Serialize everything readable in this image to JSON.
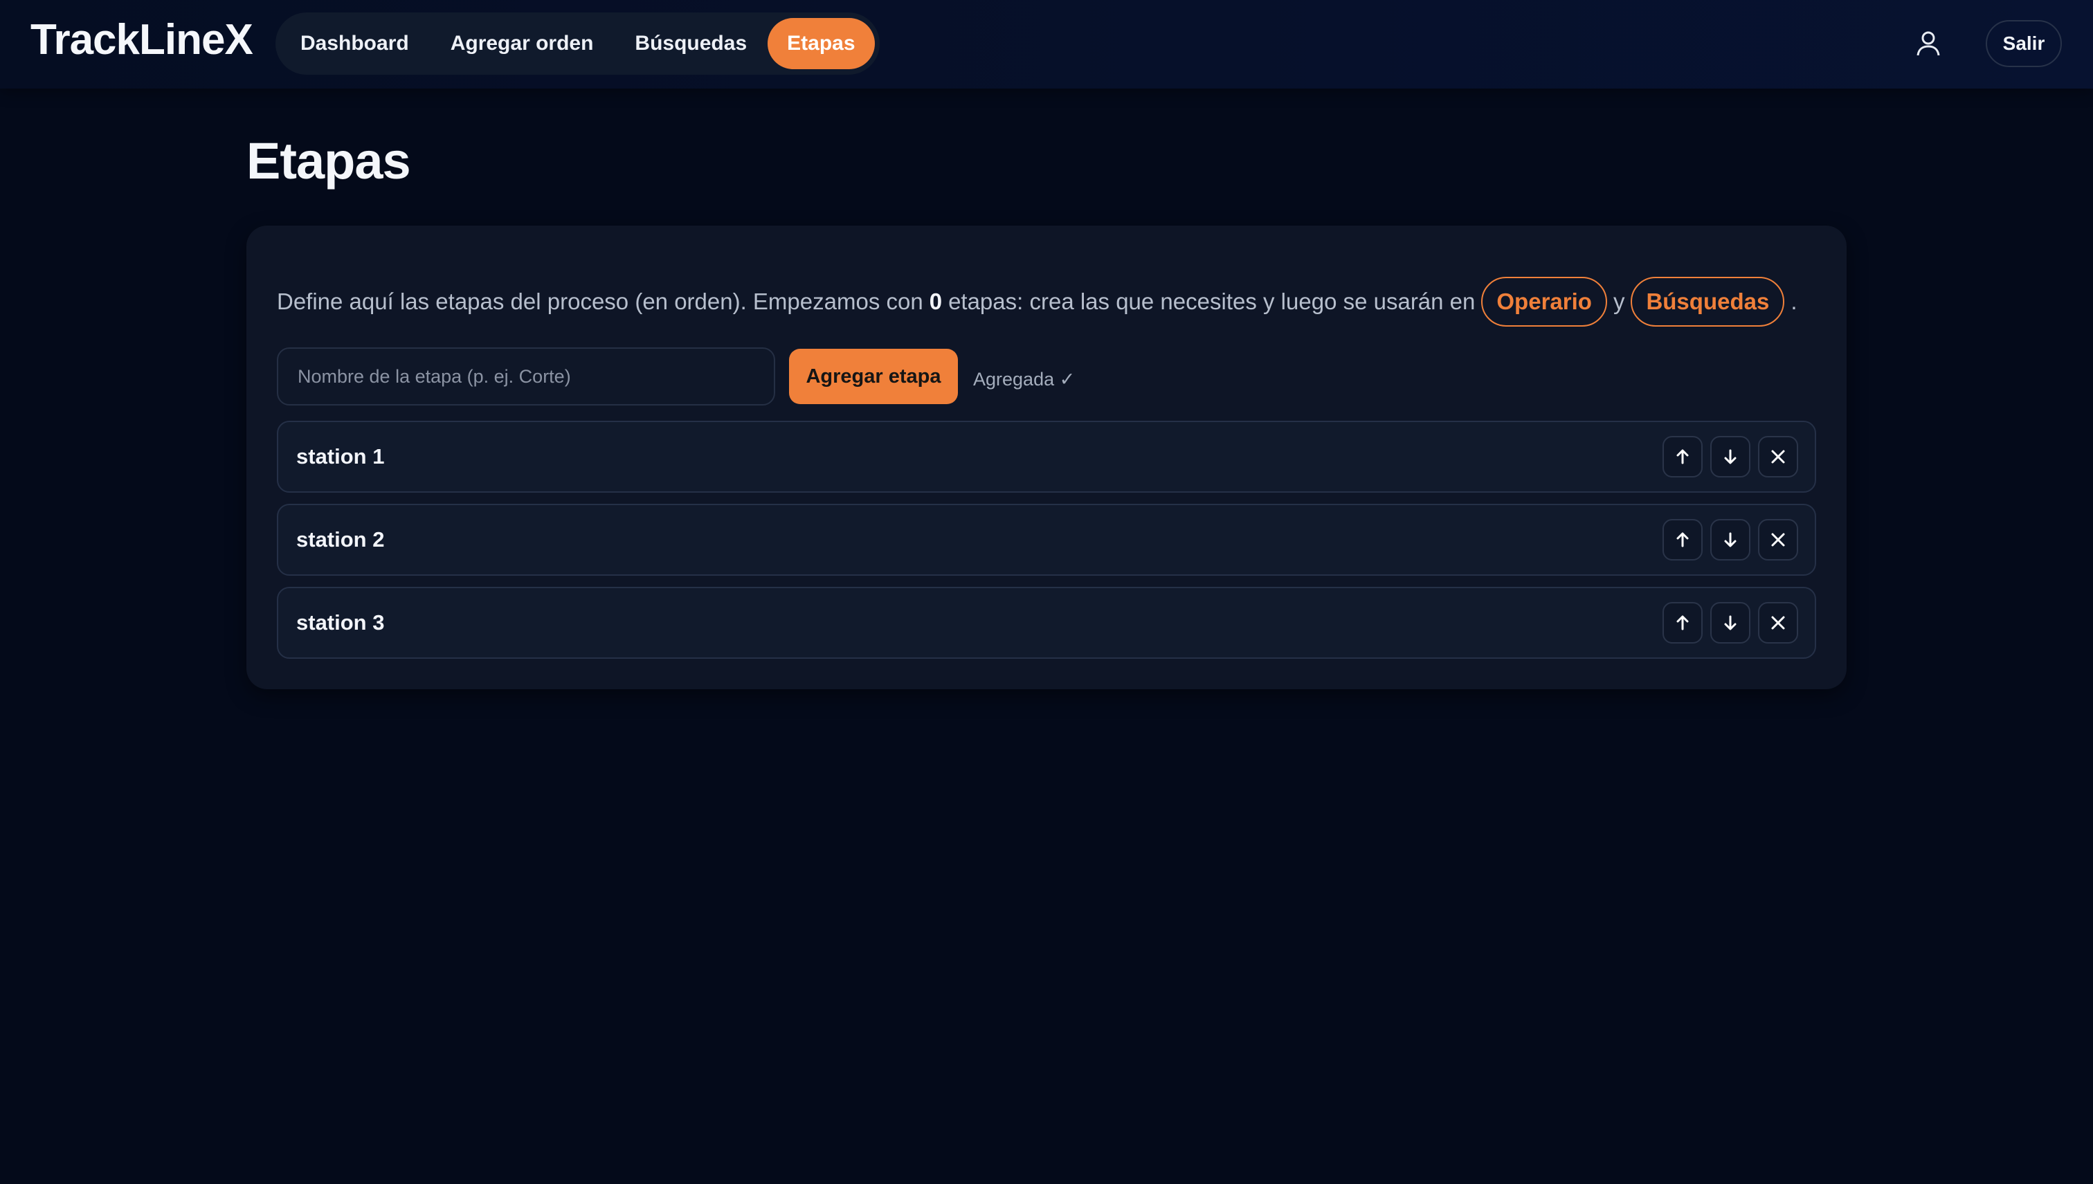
{
  "app": {
    "brand": "TrackLineX"
  },
  "nav": {
    "items": [
      {
        "label": "Dashboard",
        "active": false
      },
      {
        "label": "Agregar orden",
        "active": false
      },
      {
        "label": "Búsquedas",
        "active": false
      },
      {
        "label": "Etapas",
        "active": true
      }
    ],
    "user_icon": "user-icon",
    "logout_label": "Salir"
  },
  "page": {
    "title": "Etapas"
  },
  "intro": {
    "part1": "Define aquí las etapas del proceso (en orden). Empezamos con",
    "count": "0",
    "part2": "etapas: crea las que necesites y luego se usarán en",
    "link1": "Operario",
    "connector": "y",
    "link2": "Búsquedas",
    "end": "."
  },
  "form": {
    "input_value": "",
    "input_placeholder": "Nombre de la etapa (p. ej. Corte)",
    "add_label": "Agregar etapa",
    "status": "Agregada ✓"
  },
  "stages": [
    {
      "name": "station 1"
    },
    {
      "name": "station 2"
    },
    {
      "name": "station 3"
    }
  ],
  "icons": {
    "move_up": "arrow-up-icon",
    "move_down": "arrow-down-icon",
    "remove": "close-icon"
  },
  "colors": {
    "accent": "#f0803a",
    "background": "#040a1a",
    "card": "#0e1526"
  }
}
